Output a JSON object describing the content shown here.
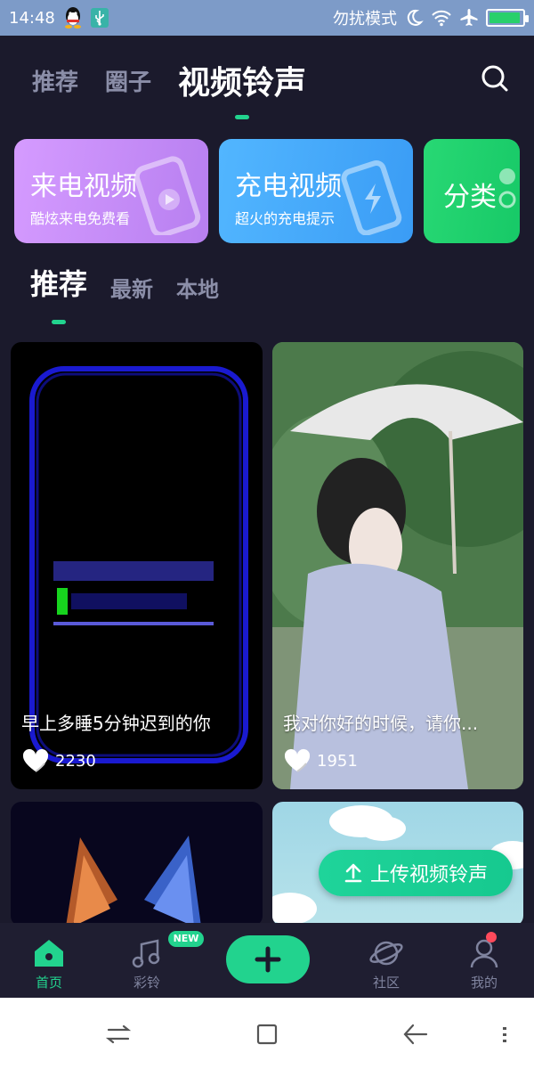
{
  "status_bar": {
    "time": "14:48",
    "dnd_label": "勿扰模式",
    "icons": [
      "qq-icon",
      "usb-icon",
      "moon-icon",
      "wifi-icon",
      "airplane-icon",
      "battery-icon"
    ],
    "battery_level": 0.95
  },
  "top_tabs": [
    {
      "label": "推荐",
      "active": false
    },
    {
      "label": "圈子",
      "active": false
    },
    {
      "label": "视频铃声",
      "active": true
    }
  ],
  "feature_cards": {
    "call": {
      "title": "来电视频",
      "subtitle": "酷炫来电免费看"
    },
    "charge": {
      "title": "充电视频",
      "subtitle": "超火的充电提示"
    },
    "category": {
      "title": "分类"
    }
  },
  "sub_tabs": [
    {
      "label": "推荐",
      "active": true
    },
    {
      "label": "最新",
      "active": false
    },
    {
      "label": "本地",
      "active": false
    }
  ],
  "videos": [
    {
      "title": "早上多睡5分钟迟到的你",
      "likes": "2230"
    },
    {
      "title": "我对你好的时候，请你...",
      "likes": "1951"
    }
  ],
  "upload_button": {
    "label": "上传视频铃声"
  },
  "bottom_nav": {
    "items": [
      {
        "label": "首页",
        "active": true
      },
      {
        "label": "彩铃",
        "active": false
      },
      {
        "label": "社区",
        "active": false
      },
      {
        "label": "我的",
        "active": false
      }
    ],
    "new_badge": "NEW"
  },
  "colors": {
    "accent": "#22d38e",
    "background": "#1b1a2c",
    "status_bar": "#7d9bc8",
    "call_card": "#c98cf8",
    "charge_card": "#45aaff",
    "category_card": "#1fd16d"
  }
}
